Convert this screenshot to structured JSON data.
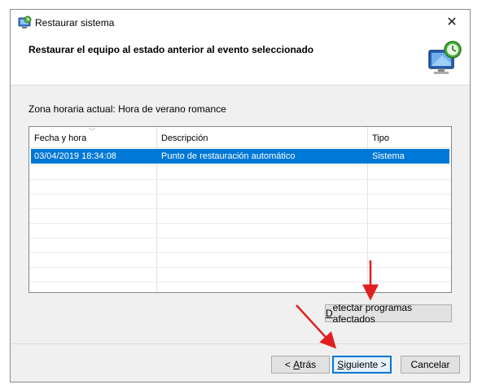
{
  "window": {
    "title": "Restaurar sistema",
    "close_glyph": "✕"
  },
  "header": {
    "title": "Restaurar el equipo al estado anterior al evento seleccionado"
  },
  "timezone_text": "Zona horaria actual: Hora de verano romance",
  "table": {
    "columns": [
      "Fecha y hora",
      "Descripción",
      "Tipo"
    ],
    "rows": [
      {
        "date": "03/04/2019 18:34:08",
        "description": "Punto de restauración automático",
        "type": "Sistema",
        "selected": true
      }
    ]
  },
  "buttons": {
    "detect_prefix": "D",
    "detect_rest": "etectar programas afectados",
    "back_prefix": "< ",
    "back_underlined": "A",
    "back_rest": "trás",
    "next_underlined": "S",
    "next_rest": "iguiente >",
    "cancel": "Cancelar"
  },
  "colors": {
    "selection": "#0078d7",
    "annotation_arrow": "#e02020"
  },
  "icons": {
    "title": "system-restore-icon",
    "header": "monitor-restore-icon",
    "close": "close-icon"
  }
}
